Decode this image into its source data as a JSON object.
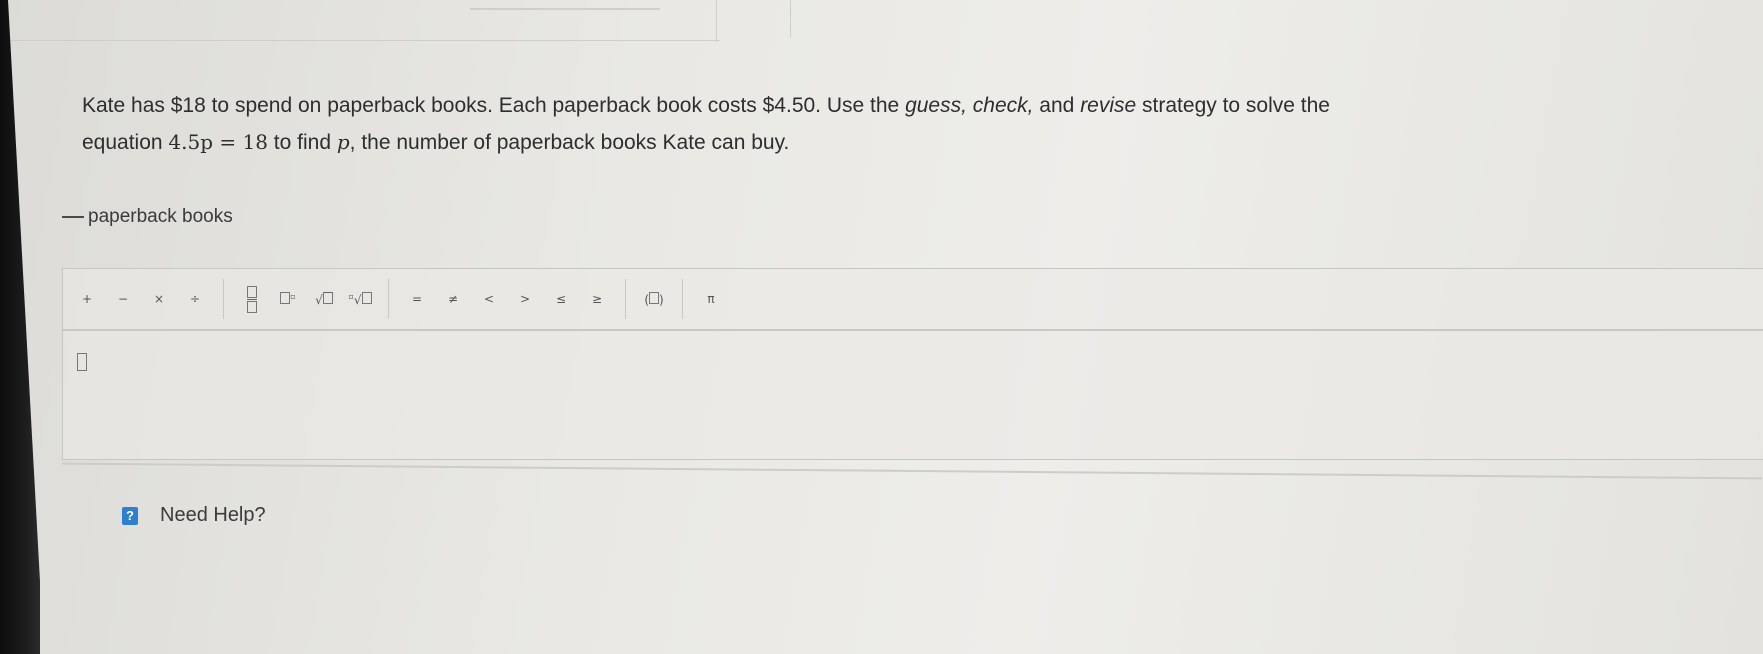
{
  "question": {
    "part1": "Kate has $18 to spend on paperback books. Each paperback book costs $4.50. Use the ",
    "em1": "guess, check,",
    "part2": " and ",
    "em2": "revise",
    "part3": " strategy to solve the",
    "line2_pre": "equation ",
    "equation": "4.5p = 18",
    "line2_mid": " to find ",
    "variable": "p",
    "line2_post": ", the number of paperback books Kate can buy."
  },
  "answer": {
    "unit_label": "paperback books"
  },
  "toolbar": {
    "plus": "+",
    "minus": "−",
    "times": "×",
    "divide": "÷",
    "equals": "=",
    "not_equal": "≠",
    "less": "<",
    "greater": ">",
    "less_equal": "≤",
    "greater_equal": "≥",
    "pi": "π"
  },
  "help": {
    "icon": "?",
    "label": "Need Help?"
  },
  "colors": {
    "help_icon": "#2f7fd1"
  }
}
